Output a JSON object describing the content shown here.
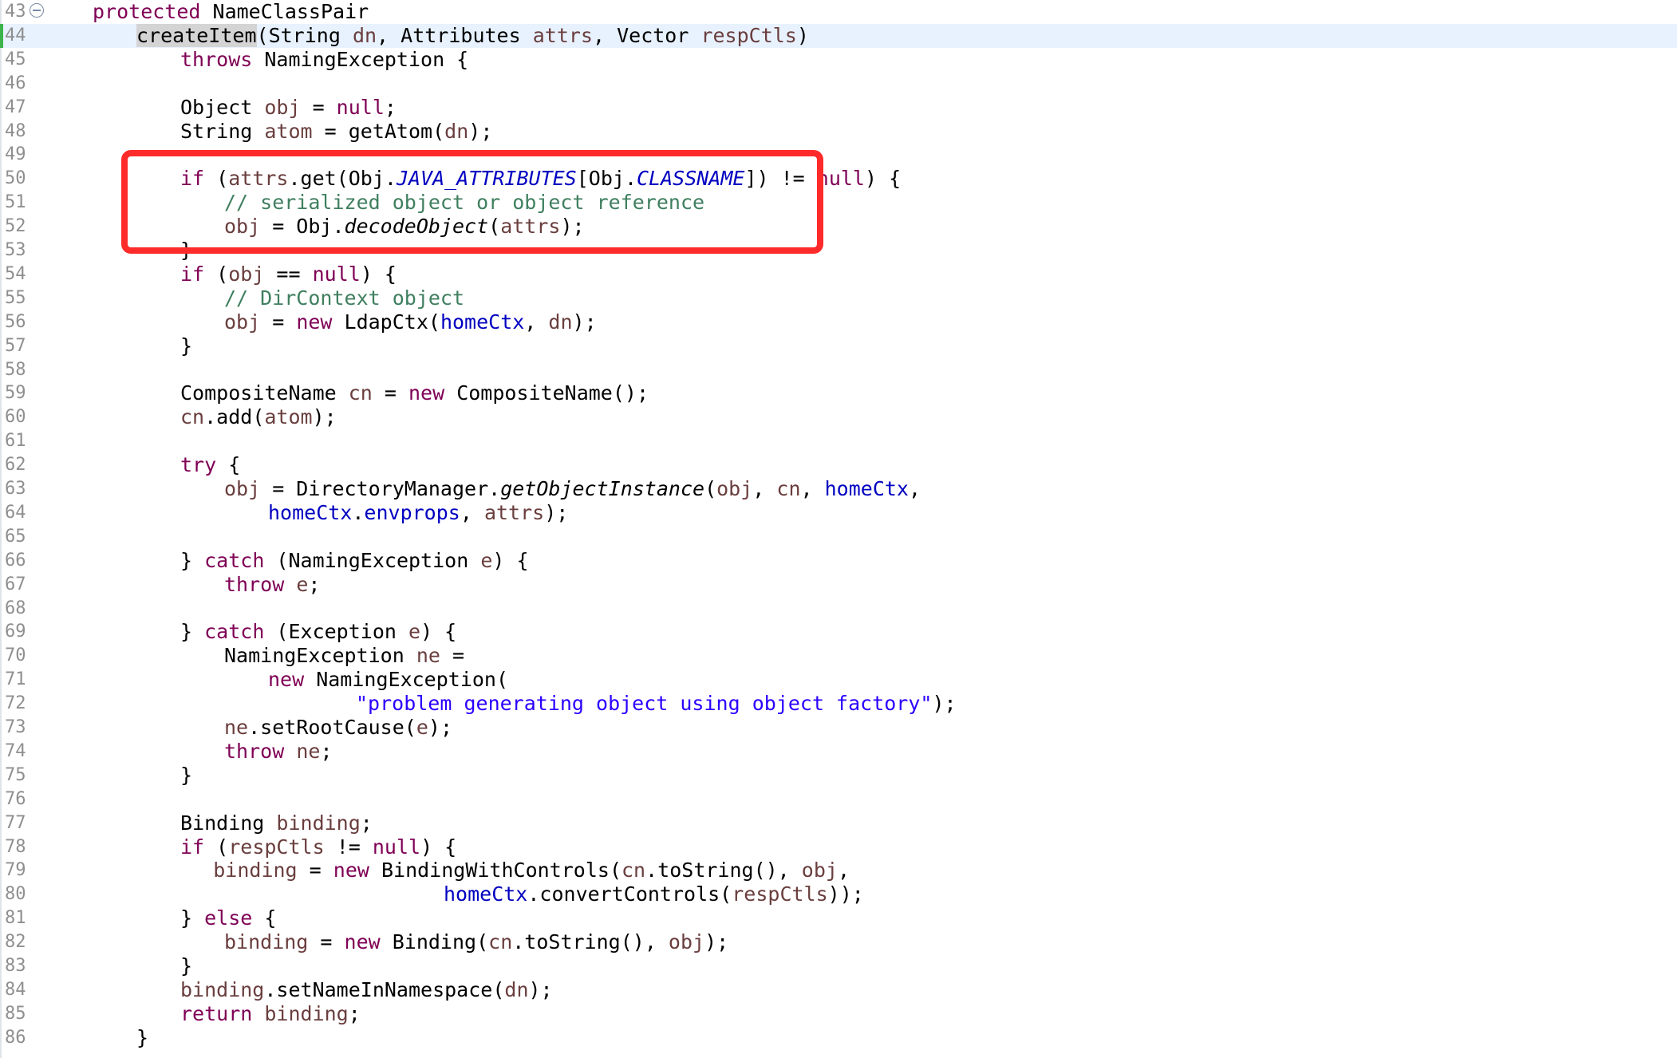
{
  "editor": {
    "lines": [
      {
        "n": "43",
        "indent": 0,
        "fold": true,
        "tokens": [
          {
            "k": "kw",
            "t": "protected"
          },
          {
            "t": " NameClassPair"
          }
        ]
      },
      {
        "n": "44",
        "indent": 1,
        "current": true,
        "changed": true,
        "tokens": [
          {
            "k": "hl",
            "t": "createItem"
          },
          {
            "t": "(String "
          },
          {
            "k": "local",
            "t": "dn"
          },
          {
            "t": ", Attributes "
          },
          {
            "k": "local",
            "t": "attrs"
          },
          {
            "t": ", Vector "
          },
          {
            "k": "local",
            "t": "respCtls"
          },
          {
            "t": ")"
          }
        ]
      },
      {
        "n": "45",
        "indent": 2,
        "tokens": [
          {
            "k": "kw",
            "t": "throws"
          },
          {
            "t": " NamingException {"
          }
        ]
      },
      {
        "n": "46",
        "indent": 0,
        "tokens": []
      },
      {
        "n": "47",
        "indent": 2,
        "tokens": [
          {
            "t": "Object "
          },
          {
            "k": "local",
            "t": "obj"
          },
          {
            "t": " = "
          },
          {
            "k": "kw",
            "t": "null"
          },
          {
            "t": ";"
          }
        ]
      },
      {
        "n": "48",
        "indent": 2,
        "tokens": [
          {
            "t": "String "
          },
          {
            "k": "local",
            "t": "atom"
          },
          {
            "t": " = getAtom("
          },
          {
            "k": "local",
            "t": "dn"
          },
          {
            "t": ");"
          }
        ]
      },
      {
        "n": "49",
        "indent": 0,
        "tokens": []
      },
      {
        "n": "50",
        "indent": 2,
        "tokens": [
          {
            "k": "kw",
            "t": "if"
          },
          {
            "t": " ("
          },
          {
            "k": "local",
            "t": "attrs"
          },
          {
            "t": ".get(Obj."
          },
          {
            "k": "static",
            "t": "JAVA_ATTRIBUTES"
          },
          {
            "t": "[Obj."
          },
          {
            "k": "static",
            "t": "CLASSNAME"
          },
          {
            "t": "]) != "
          },
          {
            "k": "kw",
            "t": "null"
          },
          {
            "t": ") {"
          }
        ]
      },
      {
        "n": "51",
        "indent": 3,
        "tokens": [
          {
            "k": "comment",
            "t": "// serialized object or object reference"
          }
        ]
      },
      {
        "n": "52",
        "indent": 3,
        "tokens": [
          {
            "k": "local",
            "t": "obj"
          },
          {
            "t": " = Obj."
          },
          {
            "k": "italic",
            "t": "decodeObject"
          },
          {
            "t": "("
          },
          {
            "k": "local",
            "t": "attrs"
          },
          {
            "t": ");"
          }
        ]
      },
      {
        "n": "53",
        "indent": 2,
        "tokens": [
          {
            "t": "}"
          }
        ]
      },
      {
        "n": "54",
        "indent": 2,
        "tokens": [
          {
            "k": "kw",
            "t": "if"
          },
          {
            "t": " ("
          },
          {
            "k": "local",
            "t": "obj"
          },
          {
            "t": " == "
          },
          {
            "k": "kw",
            "t": "null"
          },
          {
            "t": ") {"
          }
        ]
      },
      {
        "n": "55",
        "indent": 3,
        "tokens": [
          {
            "k": "comment",
            "t": "// DirContext object"
          }
        ]
      },
      {
        "n": "56",
        "indent": 3,
        "tokens": [
          {
            "k": "local",
            "t": "obj"
          },
          {
            "t": " = "
          },
          {
            "k": "kw",
            "t": "new"
          },
          {
            "t": " LdapCtx("
          },
          {
            "k": "field",
            "t": "homeCtx"
          },
          {
            "t": ", "
          },
          {
            "k": "local",
            "t": "dn"
          },
          {
            "t": ");"
          }
        ]
      },
      {
        "n": "57",
        "indent": 2,
        "tokens": [
          {
            "t": "}"
          }
        ]
      },
      {
        "n": "58",
        "indent": 0,
        "tokens": []
      },
      {
        "n": "59",
        "indent": 2,
        "tokens": [
          {
            "t": "CompositeName "
          },
          {
            "k": "local",
            "t": "cn"
          },
          {
            "t": " = "
          },
          {
            "k": "kw",
            "t": "new"
          },
          {
            "t": " CompositeName();"
          }
        ]
      },
      {
        "n": "60",
        "indent": 2,
        "tokens": [
          {
            "k": "local",
            "t": "cn"
          },
          {
            "t": ".add("
          },
          {
            "k": "local",
            "t": "atom"
          },
          {
            "t": ");"
          }
        ]
      },
      {
        "n": "61",
        "indent": 0,
        "tokens": []
      },
      {
        "n": "62",
        "indent": 2,
        "tokens": [
          {
            "k": "kw",
            "t": "try"
          },
          {
            "t": " {"
          }
        ]
      },
      {
        "n": "63",
        "indent": 3,
        "tokens": [
          {
            "k": "local",
            "t": "obj"
          },
          {
            "t": " = DirectoryManager."
          },
          {
            "k": "italic",
            "t": "getObjectInstance"
          },
          {
            "t": "("
          },
          {
            "k": "local",
            "t": "obj"
          },
          {
            "t": ", "
          },
          {
            "k": "local",
            "t": "cn"
          },
          {
            "t": ", "
          },
          {
            "k": "field",
            "t": "homeCtx"
          },
          {
            "t": ","
          }
        ]
      },
      {
        "n": "64",
        "indent": 4,
        "tokens": [
          {
            "k": "field",
            "t": "homeCtx"
          },
          {
            "t": "."
          },
          {
            "k": "field",
            "t": "envprops"
          },
          {
            "t": ", "
          },
          {
            "k": "local",
            "t": "attrs"
          },
          {
            "t": ");"
          }
        ]
      },
      {
        "n": "65",
        "indent": 0,
        "tokens": []
      },
      {
        "n": "66",
        "indent": 2,
        "tokens": [
          {
            "t": "} "
          },
          {
            "k": "kw",
            "t": "catch"
          },
          {
            "t": " (NamingException "
          },
          {
            "k": "local",
            "t": "e"
          },
          {
            "t": ") {"
          }
        ]
      },
      {
        "n": "67",
        "indent": 3,
        "tokens": [
          {
            "k": "kw",
            "t": "throw"
          },
          {
            "t": " "
          },
          {
            "k": "local",
            "t": "e"
          },
          {
            "t": ";"
          }
        ]
      },
      {
        "n": "68",
        "indent": 0,
        "tokens": []
      },
      {
        "n": "69",
        "indent": 2,
        "tokens": [
          {
            "t": "} "
          },
          {
            "k": "kw",
            "t": "catch"
          },
          {
            "t": " (Exception "
          },
          {
            "k": "local",
            "t": "e"
          },
          {
            "t": ") {"
          }
        ]
      },
      {
        "n": "70",
        "indent": 3,
        "tokens": [
          {
            "t": "NamingException "
          },
          {
            "k": "local",
            "t": "ne"
          },
          {
            "t": " ="
          }
        ]
      },
      {
        "n": "71",
        "indent": 4,
        "tokens": [
          {
            "k": "kw",
            "t": "new"
          },
          {
            "t": " NamingException("
          }
        ]
      },
      {
        "n": "72",
        "indent": 6,
        "tokens": [
          {
            "k": "string",
            "t": "\"problem generating object using object factory\""
          },
          {
            "t": ");"
          }
        ]
      },
      {
        "n": "73",
        "indent": 3,
        "tokens": [
          {
            "k": "local",
            "t": "ne"
          },
          {
            "t": ".setRootCause("
          },
          {
            "k": "local",
            "t": "e"
          },
          {
            "t": ");"
          }
        ]
      },
      {
        "n": "74",
        "indent": 3,
        "tokens": [
          {
            "k": "kw",
            "t": "throw"
          },
          {
            "t": " "
          },
          {
            "k": "local",
            "t": "ne"
          },
          {
            "t": ";"
          }
        ]
      },
      {
        "n": "75",
        "indent": 2,
        "tokens": [
          {
            "t": "}"
          }
        ]
      },
      {
        "n": "76",
        "indent": 0,
        "tokens": []
      },
      {
        "n": "77",
        "indent": 2,
        "tokens": [
          {
            "t": "Binding "
          },
          {
            "k": "local",
            "t": "binding"
          },
          {
            "t": ";"
          }
        ]
      },
      {
        "n": "78",
        "indent": 2,
        "tokens": [
          {
            "k": "kw",
            "t": "if"
          },
          {
            "t": " ("
          },
          {
            "k": "local",
            "t": "respCtls"
          },
          {
            "t": " != "
          },
          {
            "k": "kw",
            "t": "null"
          },
          {
            "t": ") {"
          }
        ]
      },
      {
        "n": "79",
        "indent": 2.75,
        "tokens": [
          {
            "k": "local",
            "t": "binding"
          },
          {
            "t": " = "
          },
          {
            "k": "kw",
            "t": "new"
          },
          {
            "t": " BindingWithControls("
          },
          {
            "k": "local",
            "t": "cn"
          },
          {
            "t": ".toString(), "
          },
          {
            "k": "local",
            "t": "obj"
          },
          {
            "t": ","
          }
        ]
      },
      {
        "n": "80",
        "indent": 8,
        "tokens": [
          {
            "k": "field",
            "t": "homeCtx"
          },
          {
            "t": ".convertControls("
          },
          {
            "k": "local",
            "t": "respCtls"
          },
          {
            "t": "));"
          }
        ]
      },
      {
        "n": "81",
        "indent": 2,
        "tokens": [
          {
            "t": "} "
          },
          {
            "k": "kw",
            "t": "else"
          },
          {
            "t": " {"
          }
        ]
      },
      {
        "n": "82",
        "indent": 3,
        "tokens": [
          {
            "k": "local",
            "t": "binding"
          },
          {
            "t": " = "
          },
          {
            "k": "kw",
            "t": "new"
          },
          {
            "t": " Binding("
          },
          {
            "k": "local",
            "t": "cn"
          },
          {
            "t": ".toString(), "
          },
          {
            "k": "local",
            "t": "obj"
          },
          {
            "t": ");"
          }
        ]
      },
      {
        "n": "83",
        "indent": 2,
        "tokens": [
          {
            "t": "}"
          }
        ]
      },
      {
        "n": "84",
        "indent": 2,
        "tokens": [
          {
            "k": "local",
            "t": "binding"
          },
          {
            "t": ".setNameInNamespace("
          },
          {
            "k": "local",
            "t": "dn"
          },
          {
            "t": ");"
          }
        ]
      },
      {
        "n": "85",
        "indent": 2,
        "tokens": [
          {
            "k": "kw",
            "t": "return"
          },
          {
            "t": " "
          },
          {
            "k": "local",
            "t": "binding"
          },
          {
            "t": ";"
          }
        ]
      },
      {
        "n": "86",
        "indent": 1,
        "tokens": [
          {
            "t": "}"
          }
        ]
      }
    ]
  },
  "colors": {
    "keyword": "#7f0055",
    "field": "#0000c0",
    "comment": "#3f7f5f",
    "string": "#2a00ff",
    "local_variable": "#6a3e3e",
    "current_line": "#e8f2fe",
    "annotation_box": "#ff2b2b"
  },
  "icons": {
    "fold": "collapse-circle-icon",
    "change": "change-bar-icon"
  }
}
